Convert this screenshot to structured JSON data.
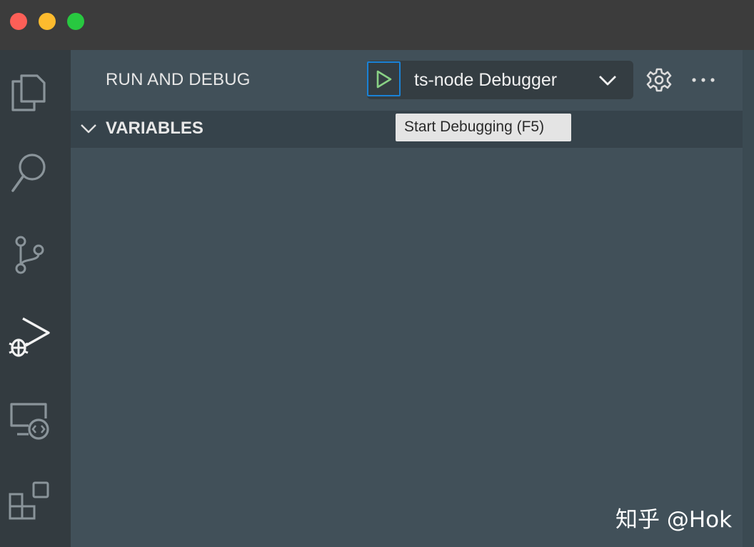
{
  "window": {
    "traffic_lights": [
      {
        "name": "close",
        "color": "#fd5f57"
      },
      {
        "name": "minimize",
        "color": "#fdbb2e"
      },
      {
        "name": "maximize",
        "color": "#28c840"
      }
    ]
  },
  "activity_bar": {
    "items": [
      {
        "name": "explorer",
        "icon": "files-icon",
        "active": false
      },
      {
        "name": "search",
        "icon": "search-icon",
        "active": false
      },
      {
        "name": "source-control",
        "icon": "source-control-icon",
        "active": false
      },
      {
        "name": "run-and-debug",
        "icon": "run-debug-icon",
        "active": true
      },
      {
        "name": "remote-explorer",
        "icon": "remote-explorer-icon",
        "active": false
      },
      {
        "name": "extensions",
        "icon": "extensions-icon",
        "active": false
      }
    ]
  },
  "sidebar": {
    "title": "RUN AND DEBUG",
    "run_button_icon": "play-icon",
    "selected_configuration": "ts-node Debugger",
    "tooltip": "Start Debugging (F5)",
    "sections": [
      {
        "title": "VARIABLES",
        "expanded": true
      }
    ]
  },
  "colors": {
    "accent_focus": "#1a82d6",
    "play_green": "#89d185",
    "sidebar_bg": "#415059",
    "activity_bg": "#333b40"
  },
  "watermark": "知乎 @Hok"
}
